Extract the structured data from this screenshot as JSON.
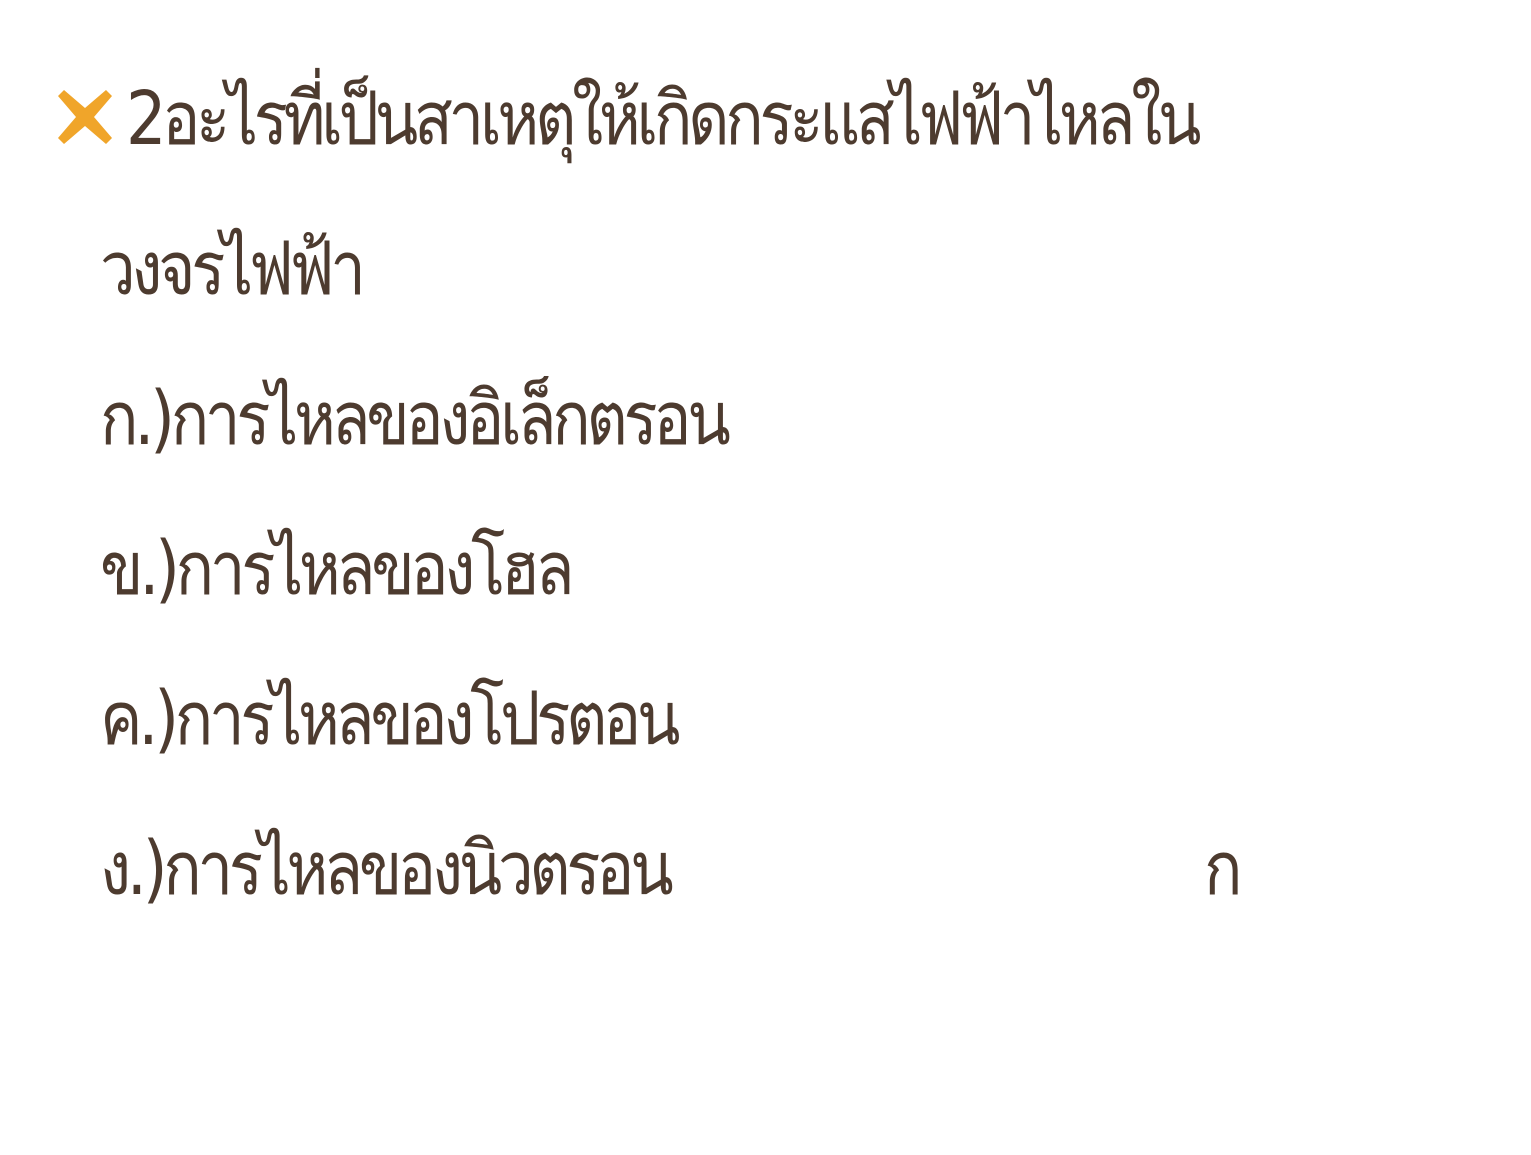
{
  "question": {
    "bullet_icon": "close-x-icon",
    "bullet_color": "#f0a52a",
    "text_color": "#4d3b2f",
    "line1": "2อะไรที่เป็นสาเหตุให้เกิดกระแสไฟฟ้าไหลใน",
    "line2": "วงจรไฟฟ้า"
  },
  "options": [
    {
      "label": "ก.)การไหลของอิเล็กตรอน"
    },
    {
      "label": "ข.)การไหลของโฮล"
    },
    {
      "label": "ค.)การไหลของโปรตอน"
    },
    {
      "label": "ง.)การไหลของนิวตรอน"
    }
  ],
  "answer": "ก"
}
